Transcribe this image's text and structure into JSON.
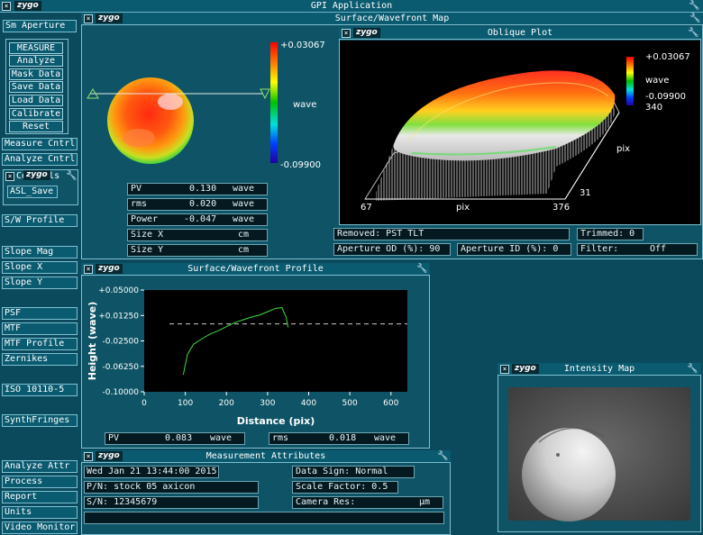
{
  "app": {
    "title": "GPI Application",
    "logo": "zygo"
  },
  "sidebar": {
    "aperture": "Sm Aperture",
    "buttons": [
      "MEASURE",
      "Analyze",
      "Mask Data",
      "Save Data",
      "Load Data",
      "Calibrate",
      "Reset"
    ],
    "controls": [
      "Measure Cntrl",
      "Analyze Cntrl"
    ],
    "tools_title": "Controls",
    "tools_item": "ASL_Save",
    "items": [
      "S/W Profile",
      "Slope Mag",
      "Slope X",
      "Slope Y",
      "PSF",
      "MTF",
      "MTF Profile",
      "Zernikes",
      "ISO 10110-5",
      "SynthFringes",
      "Analyze Attr",
      "Process",
      "Report",
      "Units",
      "Video Monitor"
    ]
  },
  "surface_map": {
    "title": "Surface/Wavefront Map",
    "scale_max": "+0.03067",
    "scale_unit": "wave",
    "scale_min": "-0.09900",
    "stats": [
      {
        "label": "PV",
        "value": "0.130",
        "unit": "wave"
      },
      {
        "label": "rms",
        "value": "0.020",
        "unit": "wave"
      },
      {
        "label": "Power",
        "value": "-0.047",
        "unit": "wave"
      },
      {
        "label": "Size X",
        "value": "",
        "unit": "cm"
      },
      {
        "label": "Size Y",
        "value": "",
        "unit": "cm"
      }
    ],
    "removed": "Removed: PST TLT",
    "trimmed": "Trimmed:  0",
    "aperture_od": "Aperture OD (%):  90",
    "aperture_id": "Aperture ID (%):  0",
    "filter": "Filter:",
    "filter_value": "Off"
  },
  "oblique": {
    "title": "Oblique Plot",
    "scale_max": "+0.03067",
    "scale_unit": "wave",
    "scale_min": "-0.09900",
    "axis_x_left": "67",
    "axis_x_label": "pix",
    "axis_x_right": "376",
    "axis_y_top": "340",
    "axis_y_label": "pix",
    "axis_y_bottom": "31"
  },
  "profile": {
    "title": "Surface/Wavefront Profile",
    "ylabel": "Height (wave)",
    "xlabel": "Distance (pix)",
    "yticks": [
      "+0.05000",
      "+0.01250",
      "-0.02500",
      "-0.06250",
      "-0.10000"
    ],
    "xticks": [
      "0",
      "100",
      "200",
      "300",
      "400",
      "500",
      "600"
    ],
    "pv_label": "PV",
    "pv_value": "0.083",
    "pv_unit": "wave",
    "rms_label": "rms",
    "rms_value": "0.018",
    "rms_unit": "wave"
  },
  "chart_data": {
    "type": "line",
    "xlabel": "Distance (pix)",
    "ylabel": "Height (wave)",
    "xlim": [
      0,
      640
    ],
    "ylim": [
      -0.1,
      0.05
    ],
    "series": [
      {
        "x": [
          95,
          105,
          120,
          140,
          160,
          180,
          200,
          220,
          240,
          260,
          280,
          300,
          320,
          335,
          345,
          350
        ],
        "values": [
          -0.075,
          -0.045,
          -0.03,
          -0.022,
          -0.015,
          -0.01,
          -0.004,
          0.002,
          0.006,
          0.01,
          0.013,
          0.018,
          0.023,
          0.024,
          0.01,
          -0.005
        ]
      }
    ],
    "reference_y": 0.0,
    "grid": false
  },
  "intensity": {
    "title": "Intensity Map"
  },
  "attributes": {
    "title": "Measurement Attributes",
    "date": "Wed Jan 21 13:44:00 2015",
    "pn": "P/N:  stock 05 axicon",
    "sn": "S/N:  12345679",
    "data_sign": "Data Sign:   Normal",
    "scale_factor": "Scale Factor:  0.5",
    "camera_res": "Camera Res:",
    "camera_unit": "µm"
  },
  "colors": {
    "background": "#0b4a5c",
    "panel": "#0e5466",
    "border": "#7fc0d2",
    "trace": "#3fdd3f"
  }
}
